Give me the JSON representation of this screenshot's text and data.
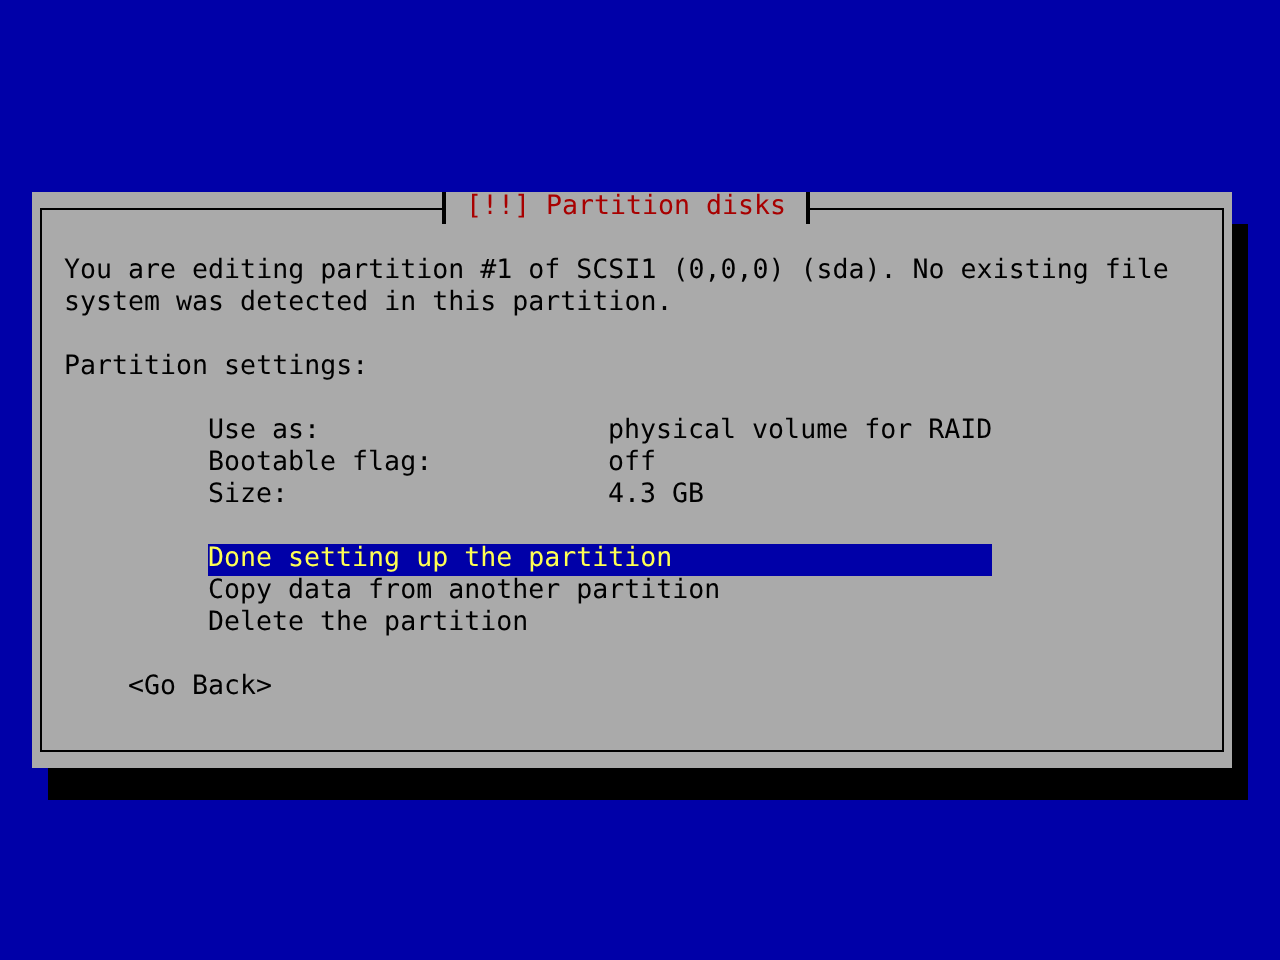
{
  "dialog": {
    "title": "[!!] Partition disks",
    "message": "You are editing partition #1 of SCSI1 (0,0,0) (sda). No existing file system was detected in this partition.",
    "section_label": "Partition settings:",
    "settings": [
      {
        "label": "Use as:",
        "value": "physical volume for RAID"
      },
      {
        "label": "Bootable flag:",
        "value": "off"
      },
      {
        "label": "Size:",
        "value": "4.3 GB"
      }
    ],
    "actions": [
      {
        "label": "Done setting up the partition",
        "selected": true
      },
      {
        "label": "Copy data from another partition",
        "selected": false
      },
      {
        "label": "Delete the partition",
        "selected": false
      }
    ],
    "back_button": "<Go Back>"
  }
}
